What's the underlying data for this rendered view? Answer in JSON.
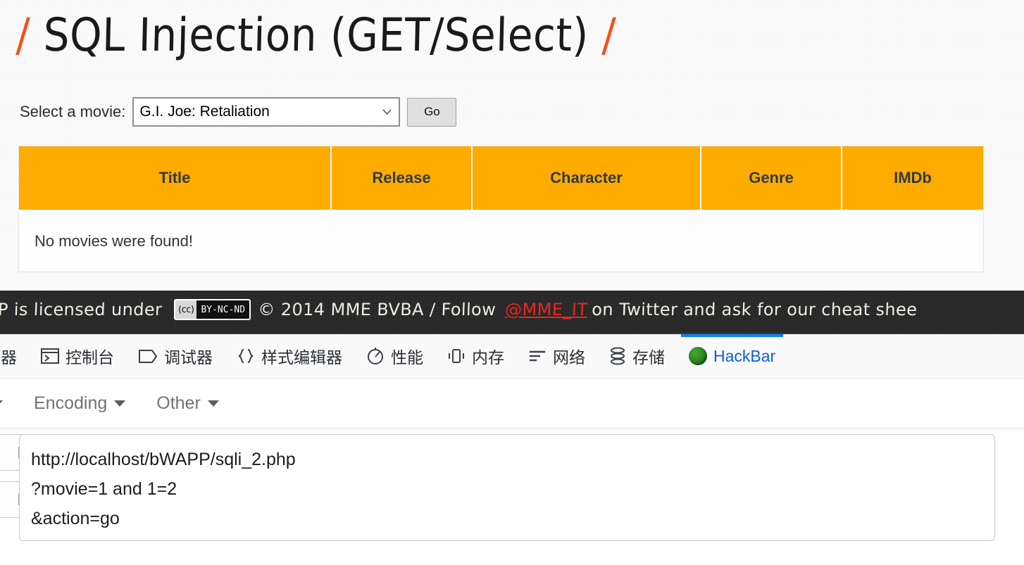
{
  "page": {
    "title_prefix": "/",
    "title": "SQL Injection (GET/Select)",
    "title_suffix": "/",
    "form": {
      "label": "Select a movie:",
      "selected_movie": "G.I. Joe: Retaliation",
      "options": [
        "G.I. Joe: Retaliation"
      ],
      "go_label": "Go"
    },
    "table": {
      "headers": [
        "Title",
        "Release",
        "Character",
        "Genre",
        "IMDb"
      ],
      "empty_message": "No movies were found!"
    },
    "footer": {
      "text_before_badge": "PP is licensed under",
      "cc_mark": "(cc)",
      "cc_terms": "BY-NC-ND",
      "copyright": "© 2014 MME BVBA / Follow",
      "handle": "@MME_IT",
      "text_after_handle": "on Twitter and ask for our cheat shee"
    }
  },
  "devtools": {
    "tabs": [
      {
        "label": "器",
        "icon": "inspector-icon",
        "active": false
      },
      {
        "label": "控制台",
        "icon": "console-icon",
        "active": false
      },
      {
        "label": "调试器",
        "icon": "debugger-icon",
        "active": false
      },
      {
        "label": "样式编辑器",
        "icon": "style-editor-icon",
        "active": false
      },
      {
        "label": "性能",
        "icon": "performance-icon",
        "active": false
      },
      {
        "label": "内存",
        "icon": "memory-icon",
        "active": false
      },
      {
        "label": "网络",
        "icon": "network-icon",
        "active": false
      },
      {
        "label": "存储",
        "icon": "storage-icon",
        "active": false
      },
      {
        "label": "HackBar",
        "icon": "hackbar-icon",
        "active": true
      }
    ]
  },
  "hackbar": {
    "menus": [
      {
        "label": "",
        "caret": "chevron-down-icon"
      },
      {
        "label": "Encoding",
        "caret": "chevron-down-icon"
      },
      {
        "label": "Other",
        "caret": "chevron-down-icon"
      }
    ],
    "buttons": [
      {
        "label": "RL",
        "name": "load-url-button"
      },
      {
        "label": "RL",
        "name": "split-url-button"
      }
    ],
    "url_value": "http://localhost/bWAPP/sqli_2.php\n?movie=1 and 1=2\n&action=go"
  },
  "colors": {
    "accent_orange": "#ffab00",
    "footer_bg": "#272727",
    "link_red": "#e8281e",
    "tab_active_blue": "#0a84ff",
    "page_bg": "#fbfbfb"
  }
}
